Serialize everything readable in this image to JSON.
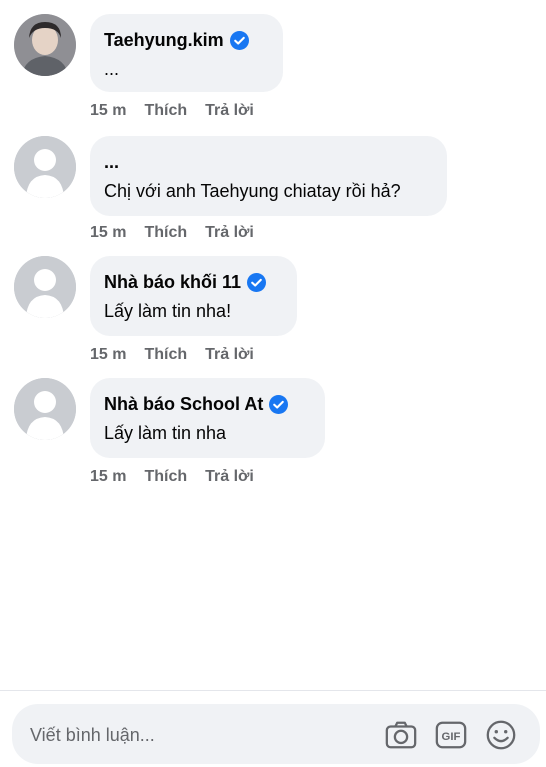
{
  "comments": [
    {
      "author": "Taehyung.kim",
      "verified": true,
      "text": "...",
      "time": "15 m",
      "like_label": "Thích",
      "reply_label": "Trả lời"
    },
    {
      "author": "...",
      "verified": false,
      "text": "Chị với anh Taehyung chiatay rồi hả?",
      "time": "15 m",
      "like_label": "Thích",
      "reply_label": "Trả lời"
    },
    {
      "author": "Nhà báo khối 11",
      "verified": true,
      "text": "Lấy làm tin nha!",
      "time": "15 m",
      "like_label": "Thích",
      "reply_label": "Trả lời"
    },
    {
      "author": "Nhà báo School At",
      "verified": true,
      "text": "Lấy làm tin nha",
      "time": "15 m",
      "like_label": "Thích",
      "reply_label": "Trả lời"
    }
  ],
  "composer": {
    "placeholder": "Viết bình luận...",
    "icons": [
      "camera-icon",
      "gif-icon",
      "emoji-icon"
    ]
  },
  "colors": {
    "bubble": "#f0f2f5",
    "verified": "#1877f2",
    "meta_text": "#65676b"
  }
}
